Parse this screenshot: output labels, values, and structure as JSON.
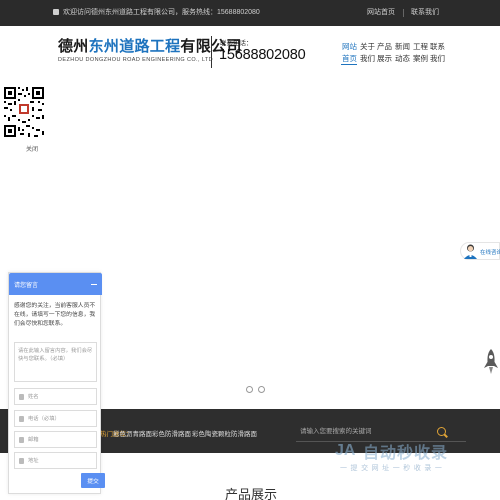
{
  "topbar": {
    "welcome": "欢迎访问德州东州道路工程有限公司，服务热线：15688802080",
    "links": [
      "网站首页",
      "联系我们"
    ]
  },
  "header": {
    "logo_part1": "德州",
    "logo_part2": "东州道路工程",
    "logo_part3": "有限公司",
    "logo_en": "DEZHOU DONGZHOU ROAD ENGINEERING CO., LTD",
    "phone_label": "联系电话：",
    "phone": "15688802080",
    "nav_top": [
      "网站",
      "关于",
      "产品",
      "新闻",
      "工程",
      "联系"
    ],
    "nav_bottom": [
      "首页",
      "我们",
      "展示",
      "动态",
      "案例",
      "我们"
    ]
  },
  "qr": {
    "close_label": "关闭"
  },
  "online_service": {
    "label": "在线咨询"
  },
  "slider": {
    "dots": 2
  },
  "hot": {
    "label": "热门推荐：",
    "items": [
      "彩色沥青路面",
      "彩色防滑路面",
      "彩色陶瓷颗粒防滑路面"
    ]
  },
  "search": {
    "placeholder": "请输入您要搜索的关键词"
  },
  "watermark": {
    "title": "自动秒收录",
    "subtitle": "一 提 交 网 址 一 秒 收 录 一"
  },
  "section": {
    "title": "产品展示"
  },
  "message_panel": {
    "title": "请您留言",
    "intro": "感谢您的关注，当前客服人员不在线，请填写一下您的信息，我们会尽快和您联系。",
    "message_placeholder": "请在此输入留言内容，我们会尽快与您联系。（必填）",
    "name_placeholder": "姓名",
    "phone_placeholder": "电话（必填）",
    "email_placeholder": "邮箱",
    "address_placeholder": "地址",
    "submit_label": "提交"
  },
  "colors": {
    "accent": "#1e73be",
    "panel_blue": "#5a8ff2",
    "dark_strip": "#2e2e2e",
    "topbar": "#2b2b2b",
    "hot_label": "#e0a437"
  }
}
